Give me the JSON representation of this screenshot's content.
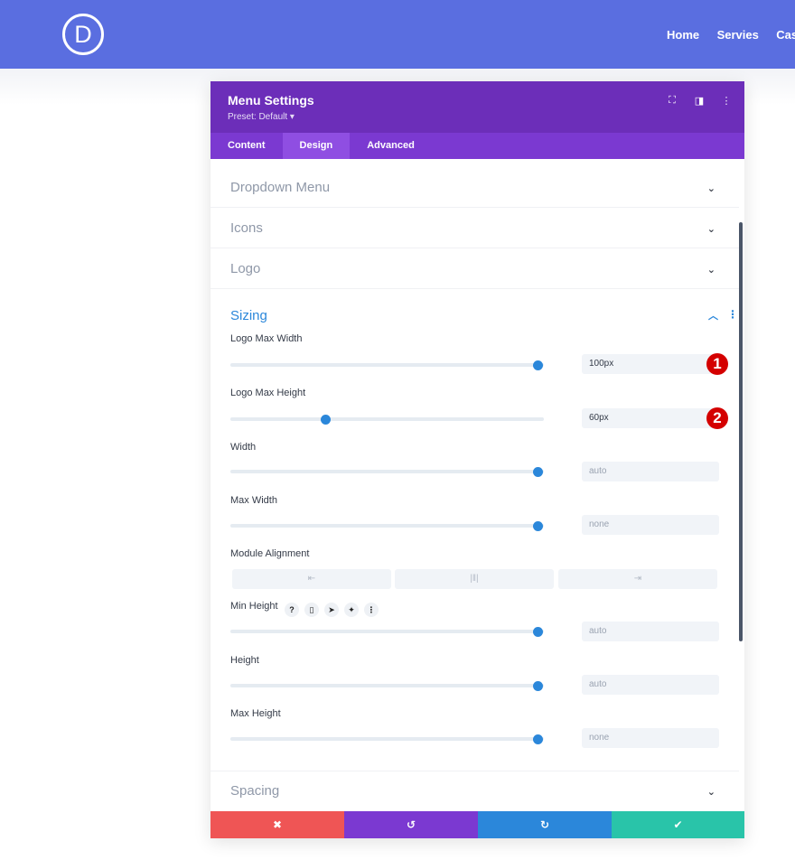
{
  "site": {
    "logo_letter": "D",
    "nav": [
      "Home",
      "Servies",
      "Case"
    ]
  },
  "modal": {
    "title": "Menu Settings",
    "preset": "Preset: Default ▾",
    "header_icons": [
      "fullscreen-icon",
      "split-view-icon",
      "more-options-icon"
    ],
    "tabs": [
      "Content",
      "Design",
      "Advanced"
    ],
    "active_tab": "Design",
    "sections": {
      "dropdown_menu": "Dropdown Menu",
      "icons": "Icons",
      "logo": "Logo",
      "sizing": "Sizing",
      "spacing": "Spacing"
    },
    "fields": {
      "logo_max_width": {
        "label": "Logo Max Width",
        "value": "100px",
        "slider_level": 1.0
      },
      "logo_max_height": {
        "label": "Logo Max Height",
        "value": "60px",
        "slider_level": 0.3
      },
      "width": {
        "label": "Width",
        "value": "auto",
        "slider_level": 1.0
      },
      "max_width": {
        "label": "Max Width",
        "value": "none",
        "slider_level": 1.0
      },
      "module_alignment": {
        "label": "Module Alignment",
        "options": [
          "align-left-icon",
          "align-center-icon",
          "align-right-icon"
        ]
      },
      "min_height": {
        "label": "Min Height",
        "value": "auto",
        "slider_level": 1.0,
        "icons": [
          "help-icon",
          "mobile-icon",
          "cursor-icon",
          "pin-icon",
          "more-icon"
        ]
      },
      "height": {
        "label": "Height",
        "value": "auto",
        "slider_level": 1.0
      },
      "max_height": {
        "label": "Max Height",
        "value": "none",
        "slider_level": 1.0
      }
    },
    "badges": [
      "1",
      "2"
    ],
    "footer": {
      "buttons": [
        {
          "name": "cancel",
          "icon": "✖",
          "color": "#ef5555"
        },
        {
          "name": "undo",
          "icon": "↺",
          "color": "#7b39d1"
        },
        {
          "name": "redo",
          "icon": "↻",
          "color": "#2b87da"
        },
        {
          "name": "save",
          "icon": "✔",
          "color": "#29c4a9"
        }
      ]
    }
  },
  "colors": {
    "header": "#5a6ee0",
    "modal_header": "#6c2eb9",
    "tabs": "#7b39d1",
    "accent": "#2b87da",
    "badge": "#d40000"
  }
}
